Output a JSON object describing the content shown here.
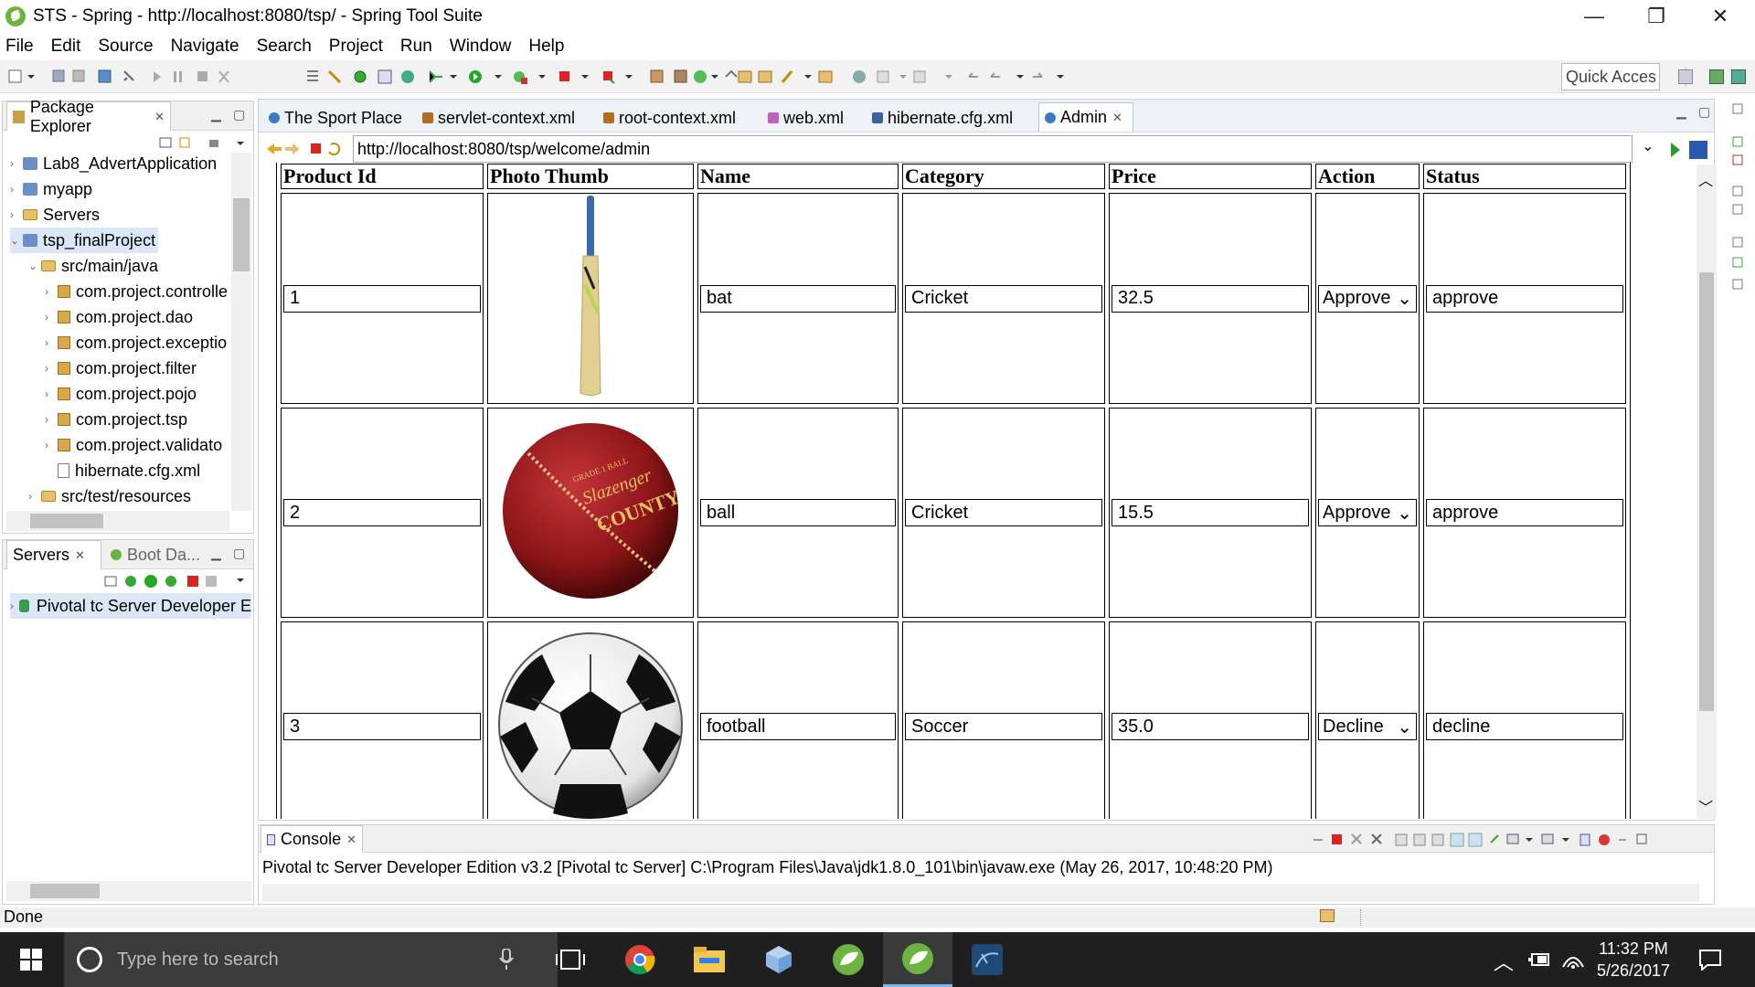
{
  "window": {
    "title": "STS - Spring - http://localhost:8080/tsp/ - Spring Tool Suite"
  },
  "menu": [
    "File",
    "Edit",
    "Source",
    "Navigate",
    "Search",
    "Project",
    "Run",
    "Window",
    "Help"
  ],
  "toolbar": {
    "quick_access": "Quick Access"
  },
  "package_explorer": {
    "title": "Package Explorer",
    "items": [
      {
        "label": "Lab8_AdvertApplication",
        "kind": "project"
      },
      {
        "label": "myapp",
        "kind": "project"
      },
      {
        "label": "Servers",
        "kind": "folder"
      },
      {
        "label": "tsp_finalProject",
        "kind": "project"
      },
      {
        "label": "src/main/java",
        "kind": "srcfolder"
      },
      {
        "label": "com.project.controlle",
        "kind": "package"
      },
      {
        "label": "com.project.dao",
        "kind": "package"
      },
      {
        "label": "com.project.exceptio",
        "kind": "package"
      },
      {
        "label": "com.project.filter",
        "kind": "package"
      },
      {
        "label": "com.project.pojo",
        "kind": "package"
      },
      {
        "label": "com.project.tsp",
        "kind": "package"
      },
      {
        "label": "com.project.validato",
        "kind": "package"
      },
      {
        "label": "hibernate.cfg.xml",
        "kind": "file"
      },
      {
        "label": "src/test/resources",
        "kind": "srcfolder"
      }
    ]
  },
  "servers_view": {
    "tab_servers": "Servers",
    "tab_boot": "Boot Da...",
    "server": "Pivotal tc Server Developer E"
  },
  "editor_tabs": [
    {
      "label": "The Sport Place",
      "color": "#3a7bc8"
    },
    {
      "label": "servlet-context.xml",
      "color": "#b07020"
    },
    {
      "label": "root-context.xml",
      "color": "#b07020"
    },
    {
      "label": "web.xml",
      "color": "#c060c0"
    },
    {
      "label": "hibernate.cfg.xml",
      "color": "#4060a0"
    },
    {
      "label": "Admin",
      "color": "#3a7bc8"
    }
  ],
  "browser": {
    "url": "http://localhost:8080/tsp/welcome/admin"
  },
  "table": {
    "headers": [
      "Product Id",
      "Photo Thumb",
      "Name",
      "Category",
      "Price",
      "Action",
      "Status"
    ],
    "rows": [
      {
        "id": "1",
        "photo": "cricket-bat",
        "name": "bat",
        "category": "Cricket",
        "price": "32.5",
        "action": "Approve",
        "status": "approve"
      },
      {
        "id": "2",
        "photo": "cricket-ball",
        "name": "ball",
        "category": "Cricket",
        "price": "15.5",
        "action": "Approve",
        "status": "approve"
      },
      {
        "id": "3",
        "photo": "soccer-ball",
        "name": "football",
        "category": "Soccer",
        "price": "35.0",
        "action": "Decline",
        "status": "decline"
      }
    ]
  },
  "ball_text": {
    "brand": "Slazenger",
    "model": "COUNTY",
    "grade": "GRADE 1 BALL"
  },
  "console": {
    "title": "Console",
    "line": "Pivotal tc Server Developer Edition v3.2 [Pivotal tc Server] C:\\Program Files\\Java\\jdk1.8.0_101\\bin\\javaw.exe (May 26, 2017, 10:48:20 PM)"
  },
  "status": "Done",
  "taskbar": {
    "search_placeholder": "Type here to search",
    "time": "11:32 PM",
    "date": "5/26/2017"
  }
}
